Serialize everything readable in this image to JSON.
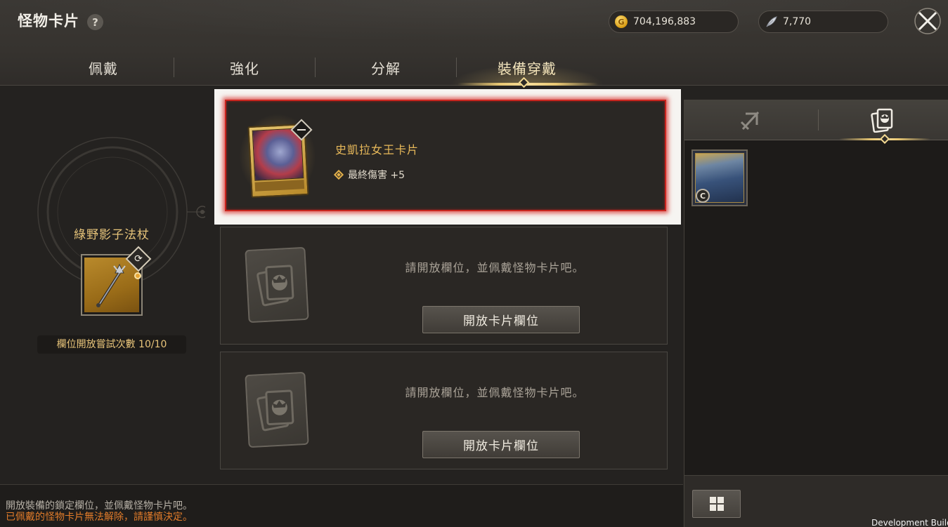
{
  "header": {
    "title": "怪物卡片",
    "help_label": "?",
    "gold_amount": "704,196,883",
    "feather_amount": "7,770"
  },
  "tabs": [
    {
      "label": "佩戴",
      "active": false
    },
    {
      "label": "強化",
      "active": false
    },
    {
      "label": "分解",
      "active": false
    },
    {
      "label": "裝備穿戴",
      "active": true
    }
  ],
  "weapon": {
    "name": "綠野影子法杖",
    "attempts_label": "欄位開放嘗試次數 10/10"
  },
  "slots": {
    "equipped": {
      "card_name": "史凱拉女王卡片",
      "stat": "最終傷害 +5"
    },
    "locked_message": "請開放欄位，並佩戴怪物卡片吧。",
    "open_button_label": "開放卡片欄位"
  },
  "inventory": {
    "grade_badge": "C"
  },
  "footer": {
    "note_1": "開放裝備的鎖定欄位，並佩戴怪物卡片吧。",
    "note_2": "已佩戴的怪物卡片無法解除，請謹慎決定。"
  },
  "build_label": "Development Build",
  "colors": {
    "accent_gold": "#e8c773",
    "warning_orange": "#e07b2a",
    "highlight_red": "#c9251f"
  }
}
